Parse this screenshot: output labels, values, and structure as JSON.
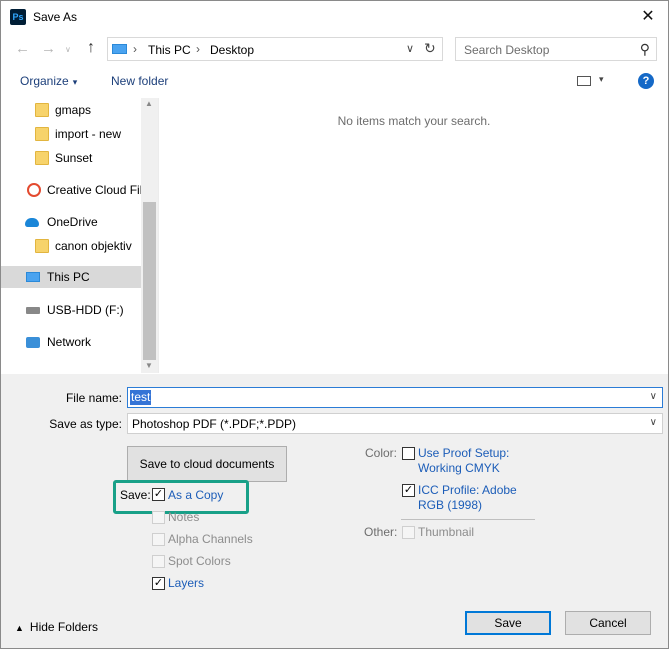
{
  "window": {
    "title": "Save As",
    "app_icon": "Ps",
    "close_glyph": "✕"
  },
  "nav": {
    "back_glyph": "←",
    "forward_glyph": "→",
    "up_glyph": "↑",
    "breadcrumb": [
      "This PC",
      "Desktop"
    ],
    "crumb_sep": "›",
    "dropdown_glyph": "∨",
    "refresh_glyph": "↻",
    "search_placeholder": "Search Desktop",
    "search_glyph": "⚲"
  },
  "command_bar": {
    "organize": "Organize",
    "new_folder": "New folder",
    "caret": "▾",
    "help": "?"
  },
  "sidebar": {
    "items": [
      {
        "label": "gmaps",
        "icon": "folder-icon"
      },
      {
        "label": "import - new",
        "icon": "folder-icon"
      },
      {
        "label": "Sunset",
        "icon": "folder-icon"
      },
      {
        "label": "Creative Cloud Fil",
        "icon": "creative-cloud-icon"
      },
      {
        "label": "OneDrive",
        "icon": "onedrive-icon"
      },
      {
        "label": "canon objektiv",
        "icon": "folder-icon"
      },
      {
        "label": "This PC",
        "icon": "this-pc-icon",
        "selected": true
      },
      {
        "label": "USB-HDD (F:)",
        "icon": "usb-drive-icon"
      },
      {
        "label": "Network",
        "icon": "network-icon"
      }
    ],
    "scroll_up": "▲",
    "scroll_down": "▼"
  },
  "content": {
    "empty_message": "No items match your search."
  },
  "form": {
    "file_name_label": "File name:",
    "file_name_value": "test",
    "save_as_type_label": "Save as type:",
    "save_as_type_value": "Photoshop PDF (*.PDF;*.PDP)",
    "caret": "∨"
  },
  "options": {
    "cloud_button": "Save to cloud documents",
    "save_label": "Save:",
    "as_a_copy": "As a Copy",
    "notes": "Notes",
    "alpha_channels": "Alpha Channels",
    "spot_colors": "Spot Colors",
    "layers": "Layers",
    "color_label": "Color:",
    "use_proof_setup_line1": "Use Proof Setup:",
    "use_proof_setup_line2": "Working CMYK",
    "icc_profile_line1": "ICC Profile:  Adobe",
    "icc_profile_line2": "RGB (1998)",
    "other_label": "Other:",
    "thumbnail": "Thumbnail",
    "check_glyph": "✓",
    "checked": {
      "as_a_copy": true,
      "notes": false,
      "alpha_channels": false,
      "spot_colors": false,
      "layers": true,
      "use_proof_setup": false,
      "icc_profile": true,
      "thumbnail": false
    }
  },
  "footer": {
    "hide_folders_glyph": "▲",
    "hide_folders": "Hide Folders",
    "save": "Save",
    "cancel": "Cancel"
  },
  "colors": {
    "accent": "#0078d7",
    "link": "#1c5db8",
    "highlight_box": "#18a088"
  }
}
